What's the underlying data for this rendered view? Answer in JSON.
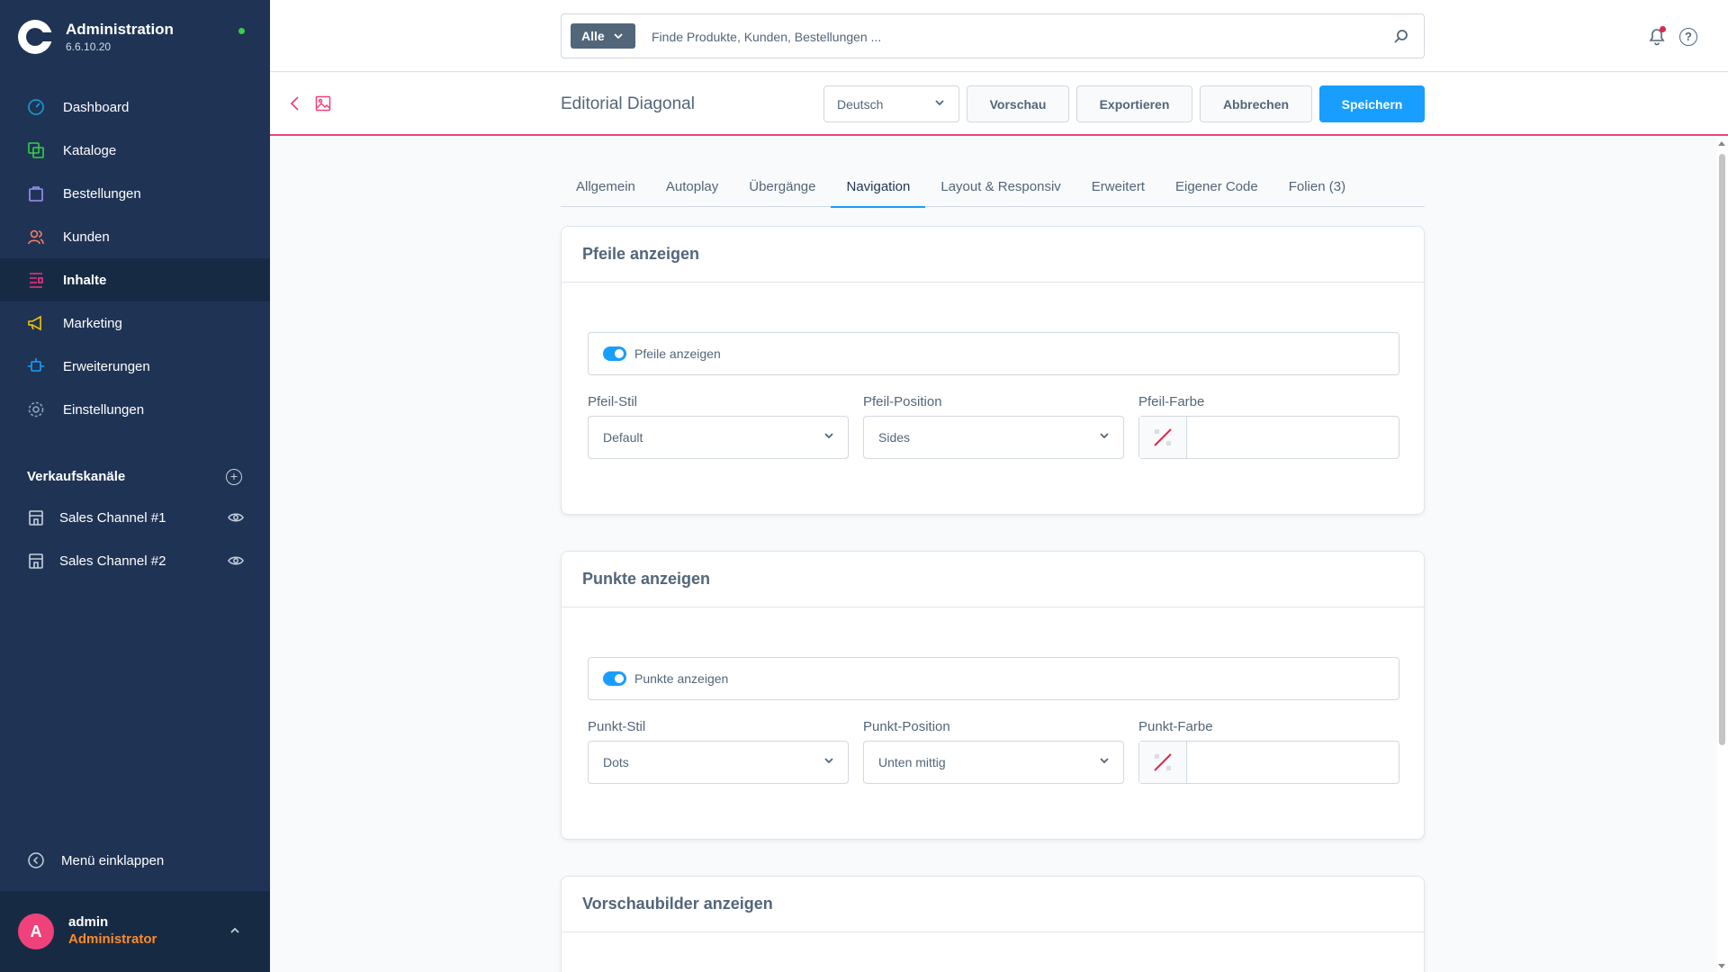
{
  "brand": {
    "title": "Administration",
    "version": "6.6.10.20"
  },
  "nav": [
    {
      "label": "Dashboard",
      "icon": "dashboard-icon",
      "color": "#1a9bd6"
    },
    {
      "label": "Kataloge",
      "icon": "catalog-icon",
      "color": "#37d046"
    },
    {
      "label": "Bestellungen",
      "icon": "orders-icon",
      "color": "#a092f0"
    },
    {
      "label": "Kunden",
      "icon": "customers-icon",
      "color": "#f97c63"
    },
    {
      "label": "Inhalte",
      "icon": "content-icon",
      "color": "#f03380"
    },
    {
      "label": "Marketing",
      "icon": "marketing-icon",
      "color": "#f5c200"
    },
    {
      "label": "Erweiterungen",
      "icon": "extensions-icon",
      "color": "#189eff"
    },
    {
      "label": "Einstellungen",
      "icon": "settings-icon",
      "color": "#8fa0b6"
    }
  ],
  "sales_channels": {
    "title": "Verkaufskanäle",
    "items": [
      {
        "label": "Sales Channel #1"
      },
      {
        "label": "Sales Channel #2"
      }
    ]
  },
  "collapse_label": "Menü einklappen",
  "user": {
    "initial": "A",
    "name": "admin",
    "role": "Administrator"
  },
  "search": {
    "type": "Alle",
    "placeholder": "Finde Produkte, Kunden, Bestellungen ..."
  },
  "smartbar": {
    "title": "Editorial Diagonal",
    "language": "Deutsch",
    "buttons": {
      "preview": "Vorschau",
      "export": "Exportieren",
      "cancel": "Abbrechen",
      "save": "Speichern"
    }
  },
  "tabs": [
    "Allgemein",
    "Autoplay",
    "Übergänge",
    "Navigation",
    "Layout & Responsiv",
    "Erweitert",
    "Eigener Code",
    "Folien (3)"
  ],
  "active_tab": "Navigation",
  "cards": {
    "arrows": {
      "title": "Pfeile anzeigen",
      "switch_label": "Pfeile anzeigen",
      "enabled": true,
      "style_label": "Pfeil-Stil",
      "style_value": "Default",
      "position_label": "Pfeil-Position",
      "position_value": "Sides",
      "color_label": "Pfeil-Farbe",
      "color_value": ""
    },
    "dots": {
      "title": "Punkte anzeigen",
      "switch_label": "Punkte anzeigen",
      "enabled": true,
      "style_label": "Punkt-Stil",
      "style_value": "Dots",
      "position_label": "Punkt-Position",
      "position_value": "Unten mittig",
      "color_label": "Punkt-Farbe",
      "color_value": ""
    },
    "thumbnails": {
      "title": "Vorschaubilder anzeigen"
    }
  },
  "colors": {
    "sidebar": "#1f3455",
    "primary": "#189eff",
    "accent": "#f0427a",
    "status": "#37d046",
    "role": "#fb8a2c"
  }
}
